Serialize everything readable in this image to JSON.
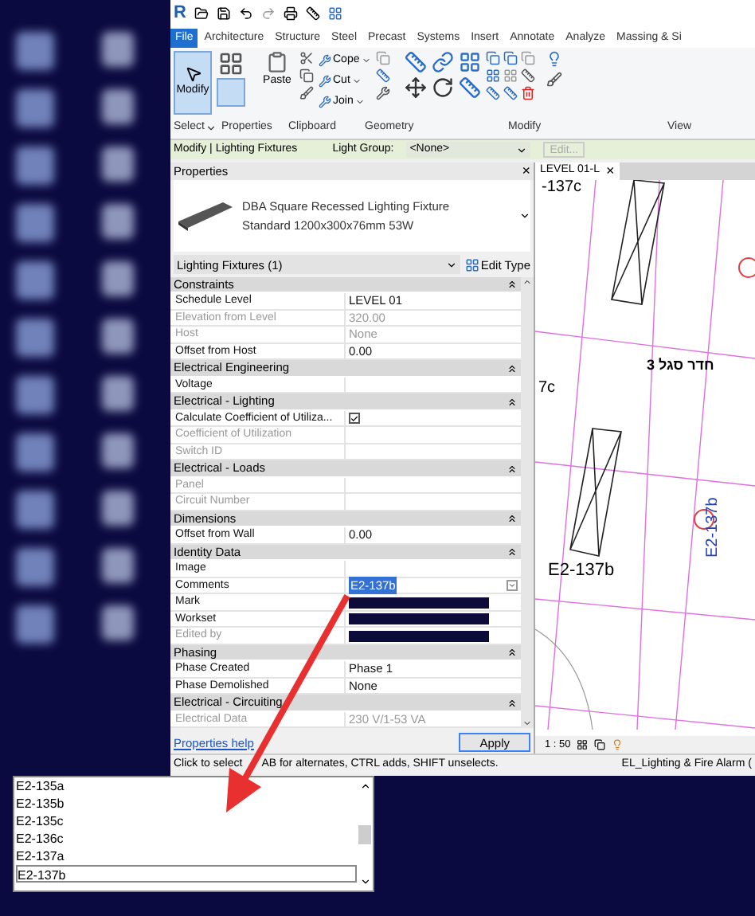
{
  "app_logo": "R",
  "tabs": [
    {
      "label": "File",
      "selected": true
    },
    {
      "label": "Architecture",
      "selected": false
    },
    {
      "label": "Structure",
      "selected": false
    },
    {
      "label": "Steel",
      "selected": false
    },
    {
      "label": "Precast",
      "selected": false
    },
    {
      "label": "Systems",
      "selected": false
    },
    {
      "label": "Insert",
      "selected": false
    },
    {
      "label": "Annotate",
      "selected": false
    },
    {
      "label": "Analyze",
      "selected": false
    },
    {
      "label": "Massing & Si",
      "selected": false
    }
  ],
  "ribbon": {
    "modify_button": {
      "label": "Modify",
      "selected": true
    },
    "paste_label": "Paste",
    "small_tools": [
      "Cope",
      "Cut",
      "Join"
    ],
    "panels": [
      {
        "label": "Select",
        "dropdown": true
      },
      {
        "label": "Properties",
        "dropdown": false
      },
      {
        "label": "Clipboard",
        "dropdown": false
      },
      {
        "label": "Geometry",
        "dropdown": false
      },
      {
        "label": "Modify",
        "dropdown": false
      },
      {
        "label": "View",
        "dropdown": false
      }
    ]
  },
  "options_bar": {
    "context": "Modify | Lighting Fixtures",
    "light_group_label": "Light Group:",
    "light_group_value": "<None>",
    "edit_button": {
      "label": "Edit...",
      "disabled": true
    }
  },
  "properties": {
    "title": "Properties",
    "close": "×",
    "type_name": "DBA Square Recessed Lighting Fixture",
    "type_detail": "Standard 1200x300x76mm 53W",
    "filter": "Lighting Fixtures (1)",
    "edit_type": "Edit Type",
    "rows": [
      {
        "kind": "group",
        "label": "Constraints"
      },
      {
        "kind": "param",
        "label": "Schedule Level",
        "value": "LEVEL 01",
        "disabled": false
      },
      {
        "kind": "param",
        "label": "Elevation from Level",
        "value": "320.00",
        "disabled": true
      },
      {
        "kind": "param",
        "label": "Host",
        "value": "None",
        "disabled": true
      },
      {
        "kind": "param",
        "label": "Offset from Host",
        "value": "0.00",
        "disabled": false
      },
      {
        "kind": "group",
        "label": "Electrical Engineering"
      },
      {
        "kind": "param",
        "label": "Voltage",
        "disabled": false
      },
      {
        "kind": "group",
        "label": "Electrical - Lighting"
      },
      {
        "kind": "check",
        "label": "Calculate Coefficient of Utiliza...",
        "checked": true,
        "disabled": false
      },
      {
        "kind": "param",
        "label": "Coefficient of Utilization",
        "disabled": true
      },
      {
        "kind": "param",
        "label": "Switch ID",
        "disabled": true
      },
      {
        "kind": "group",
        "label": "Electrical - Loads"
      },
      {
        "kind": "param",
        "label": "Panel",
        "disabled": true
      },
      {
        "kind": "param",
        "label": "Circuit Number",
        "disabled": true
      },
      {
        "kind": "group",
        "label": "Dimensions"
      },
      {
        "kind": "param",
        "label": "Offset from Wall",
        "value": "0.00",
        "disabled": false
      },
      {
        "kind": "group",
        "label": "Identity Data"
      },
      {
        "kind": "param",
        "label": "Image",
        "disabled": false
      },
      {
        "kind": "editing",
        "label": "Comments",
        "value": "E2-137b",
        "disabled": false
      },
      {
        "kind": "redacted",
        "label": "Mark",
        "disabled": false
      },
      {
        "kind": "redacted",
        "label": "Workset",
        "disabled": false
      },
      {
        "kind": "redacted",
        "label": "Edited by",
        "disabled": true
      },
      {
        "kind": "group",
        "label": "Phasing"
      },
      {
        "kind": "param",
        "label": "Phase Created",
        "value": "Phase 1",
        "disabled": false
      },
      {
        "kind": "param",
        "label": "Phase Demolished",
        "value": "None",
        "disabled": false
      },
      {
        "kind": "group",
        "label": "Electrical - Circuiting"
      },
      {
        "kind": "param",
        "label": "Electrical Data",
        "value": "230 V/1-53 VA",
        "disabled": true
      }
    ],
    "help_link": "Properties help",
    "apply": "Apply"
  },
  "view": {
    "tab": "LEVEL 01-L",
    "close": "×",
    "labels": [
      "-137c",
      "7c",
      "E2-137b"
    ],
    "room_name": "חדר סגל 3",
    "tag": "E2-137b",
    "scale": "1 : 50",
    "workset": "EL_Lighting & Fire Alarm ("
  },
  "status_bar": [
    "Click to select",
    "AB for alternates, CTRL adds, SHIFT unselects."
  ],
  "list": {
    "items": [
      {
        "label": "E2-135a",
        "selected": false
      },
      {
        "label": "E2-135b",
        "selected": false
      },
      {
        "label": "E2-135c",
        "selected": false
      },
      {
        "label": "E2-136c",
        "selected": false
      },
      {
        "label": "E2-137a",
        "selected": false
      },
      {
        "label": "E2-137b",
        "selected": true
      }
    ]
  }
}
